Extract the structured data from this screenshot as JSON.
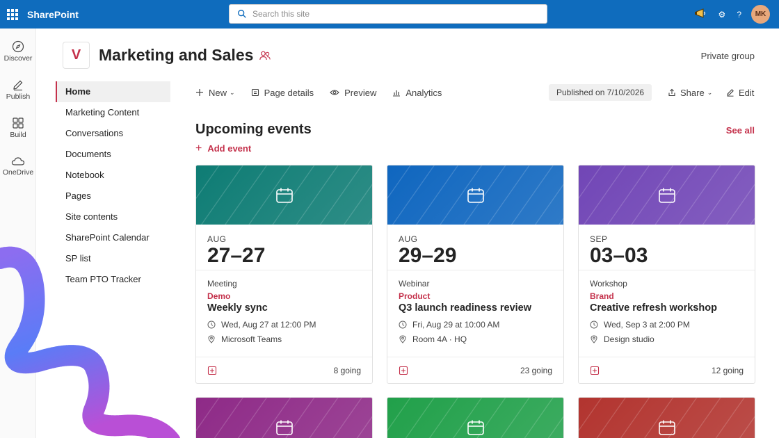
{
  "suite": {
    "app_name": "SharePoint",
    "search_placeholder": "Search this site",
    "avatar_initials": "MK"
  },
  "appbar": [
    {
      "label": "Discover",
      "icon": "compass-icon"
    },
    {
      "label": "Publish",
      "icon": "pen-icon"
    },
    {
      "label": "Build",
      "icon": "grid-icon"
    },
    {
      "label": "OneDrive",
      "icon": "cloud-icon"
    }
  ],
  "site": {
    "logo_letter": "V",
    "title": "Marketing and Sales",
    "privacy": "Private group"
  },
  "nav": [
    "Home",
    "Marketing Content",
    "Conversations",
    "Documents",
    "Notebook",
    "Pages",
    "Site contents",
    "SharePoint Calendar",
    "SP list",
    "Team PTO Tracker"
  ],
  "command_bar": {
    "new": "New",
    "page_details": "Page details",
    "preview": "Preview",
    "analytics": "Analytics",
    "published": "Published on 7/10/2026",
    "share": "Share",
    "edit": "Edit"
  },
  "events": {
    "title": "Upcoming events",
    "see_all": "See all",
    "add_event": "Add event",
    "cards": [
      {
        "color": "#0e7c74",
        "month": "AUG",
        "day": "27–27",
        "type": "Meeting",
        "category": "Demo",
        "title": "Weekly sync",
        "when": "Wed, Aug 27 at 12:00 PM",
        "where": "Microsoft Teams",
        "going": "8 going"
      },
      {
        "color": "#0f66bf",
        "month": "AUG",
        "day": "29–29",
        "type": "Webinar",
        "category": "Product",
        "title": "Q3 launch readiness review",
        "when": "Fri, Aug 29 at 10:00 AM",
        "where": "Room 4A · HQ",
        "going": "23 going"
      },
      {
        "color": "#7146b6",
        "month": "SEP",
        "day": "03–03",
        "type": "Workshop",
        "category": "Brand",
        "title": "Creative refresh workshop",
        "when": "Wed, Sep 3 at 2:00 PM",
        "where": "Design studio",
        "going": "12 going"
      }
    ],
    "more_card_colors": [
      "#8e2a87",
      "#21a04a",
      "#b2342f"
    ]
  }
}
